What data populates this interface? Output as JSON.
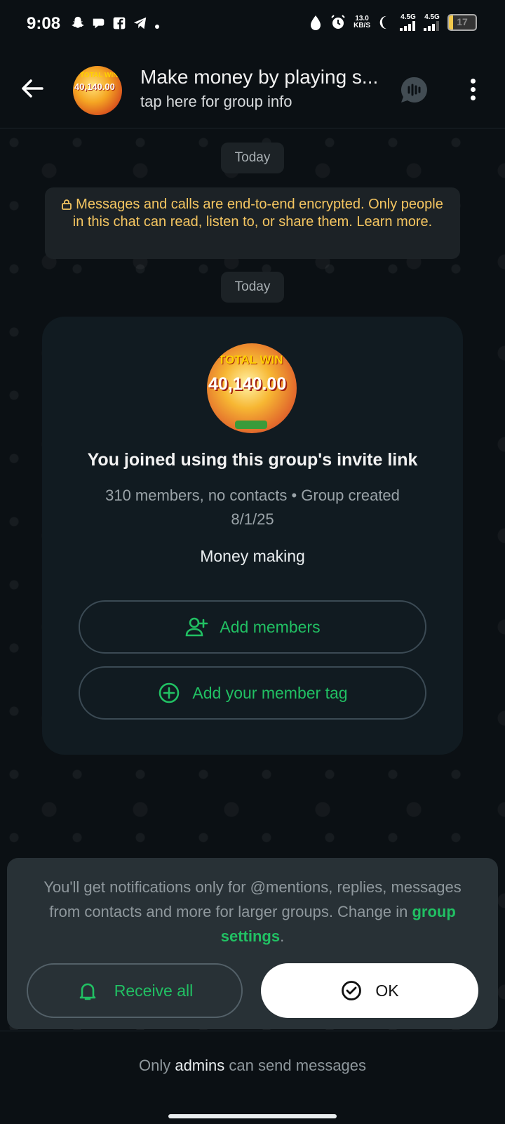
{
  "status_bar": {
    "time": "9:08",
    "left_icons": [
      "snapchat-icon",
      "chat-icon",
      "facebook-icon",
      "telegram-icon",
      "dot-icon"
    ],
    "net_speed_value": "13.0",
    "net_speed_unit": "KB/S",
    "signal1_label": "4.5G",
    "signal2_label": "4.5G",
    "battery": "17"
  },
  "header": {
    "title": "Make money by playing s...",
    "subtitle": "tap here for group info",
    "avatar_top": "TOTAL WIN",
    "avatar_amount": "40,140.00"
  },
  "chat": {
    "date_chip_1": "Today",
    "encryption_notice": "Messages and calls are end-to-end encrypted. Only people in this chat can read, listen to, or share them. Learn more.",
    "date_chip_2": "Today",
    "card": {
      "avatar_top": "TOTAL WIN",
      "avatar_amount": "40,140.00",
      "title": "You joined using this group's invite link",
      "subtitle": "310 members, no contacts • Group created 8/1/25",
      "description": "Money making",
      "add_members": "Add members",
      "add_member_tag": "Add your member tag"
    }
  },
  "notice": {
    "text_before": "You'll get notifications only for @mentions, replies, messages from contacts and more for larger groups. Change in ",
    "link": "group settings",
    "text_after": ".",
    "receive_all": "Receive all",
    "ok": "OK"
  },
  "footer": {
    "text_before": "Only ",
    "bold": "admins",
    "text_after": " can send messages"
  },
  "colors": {
    "accent": "#21c063",
    "encryption_text": "#f5c661",
    "background": "#0b1014"
  }
}
